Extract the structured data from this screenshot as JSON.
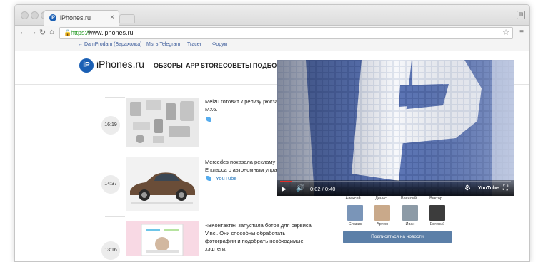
{
  "browser": {
    "tab_title": "iPhones.ru",
    "tab_close": "×",
    "url_protocol": "https://",
    "url_host": "www.iphones.ru",
    "menu_icon": "≡",
    "bookmarks": [
      "← DamProdam (Барахолка)",
      "Мы в Telegram",
      "Tracer",
      "Форум"
    ]
  },
  "site": {
    "logo_mark": "iP",
    "logo_text": "iPhones.ru",
    "nav": [
      "ОБЗОРЫ",
      "APP STORE",
      "СОВЕТЫ",
      "ПОДБОР"
    ]
  },
  "articles": [
    {
      "time": "16:19",
      "text_line1": "Meizu готовит к релизу рюкзак",
      "text_line2": "MX6.",
      "source": ""
    },
    {
      "time": "14:37",
      "text_line1": "Mercedes показала рекламу но",
      "text_line2": "E класса с автономным управл",
      "source": "YouTube"
    },
    {
      "time": "13:16",
      "text_line1": "«ВКонтакте» запустила ботов для сервиса",
      "text_line2": "Vinci. Они способны обработать",
      "text_line3": "фотографии и подобрать необходимые",
      "text_line4": "хэштеги.",
      "source": ""
    }
  ],
  "video": {
    "time": "0:02 / 0:40",
    "progress": 0.05,
    "logo": "YouTube"
  },
  "friends": {
    "top_names": [
      "Алексей",
      "Денис",
      "Василий",
      "Виктор"
    ],
    "bottom_names": [
      "Славик",
      "Артем",
      "Иван",
      "Евгений"
    ],
    "subscribe_label": "Подписаться на новости"
  }
}
